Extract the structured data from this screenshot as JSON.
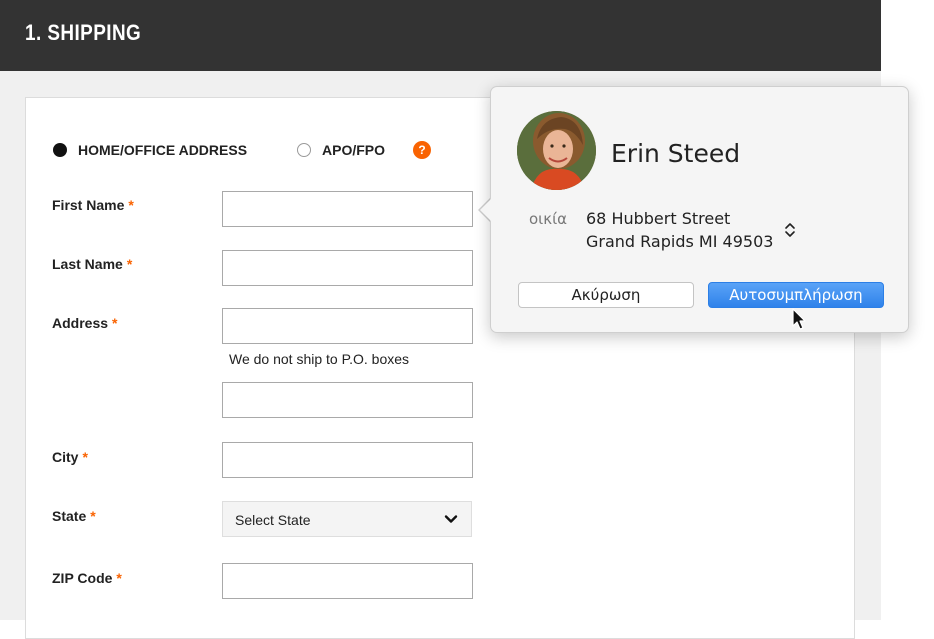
{
  "header": {
    "title": "1. SHIPPING"
  },
  "address_type": {
    "options": [
      {
        "label": "HOME/OFFICE ADDRESS",
        "checked": true
      },
      {
        "label": "APO/FPO",
        "checked": false
      }
    ],
    "help_icon": "?"
  },
  "form": {
    "required_marker": "*",
    "first_name": {
      "label": "First Name",
      "value": ""
    },
    "last_name": {
      "label": "Last Name",
      "value": ""
    },
    "address": {
      "label": "Address",
      "value": "",
      "line2_value": "",
      "note": "We do not ship to P.O. boxes"
    },
    "city": {
      "label": "City",
      "value": ""
    },
    "state": {
      "label": "State",
      "selected": "Select State"
    },
    "zip": {
      "label": "ZIP Code",
      "value": ""
    }
  },
  "autofill_popover": {
    "contact_name": "Erin Steed",
    "address_label": "οικία",
    "address_line1": "68 Hubbert Street",
    "address_line2": "Grand Rapids MI 49503",
    "cancel_label": "Ακύρωση",
    "autofill_label": "Αυτοσυμπλήρωση"
  },
  "colors": {
    "header_bg": "#333333",
    "accent_orange": "#f96302",
    "primary_blue": "#2f82ea"
  },
  "icons": {
    "help": "help-icon",
    "select_chevron": "chevron-down-icon",
    "address_stepper": "up-down-chevron-icon",
    "cursor": "mouse-pointer-icon"
  }
}
